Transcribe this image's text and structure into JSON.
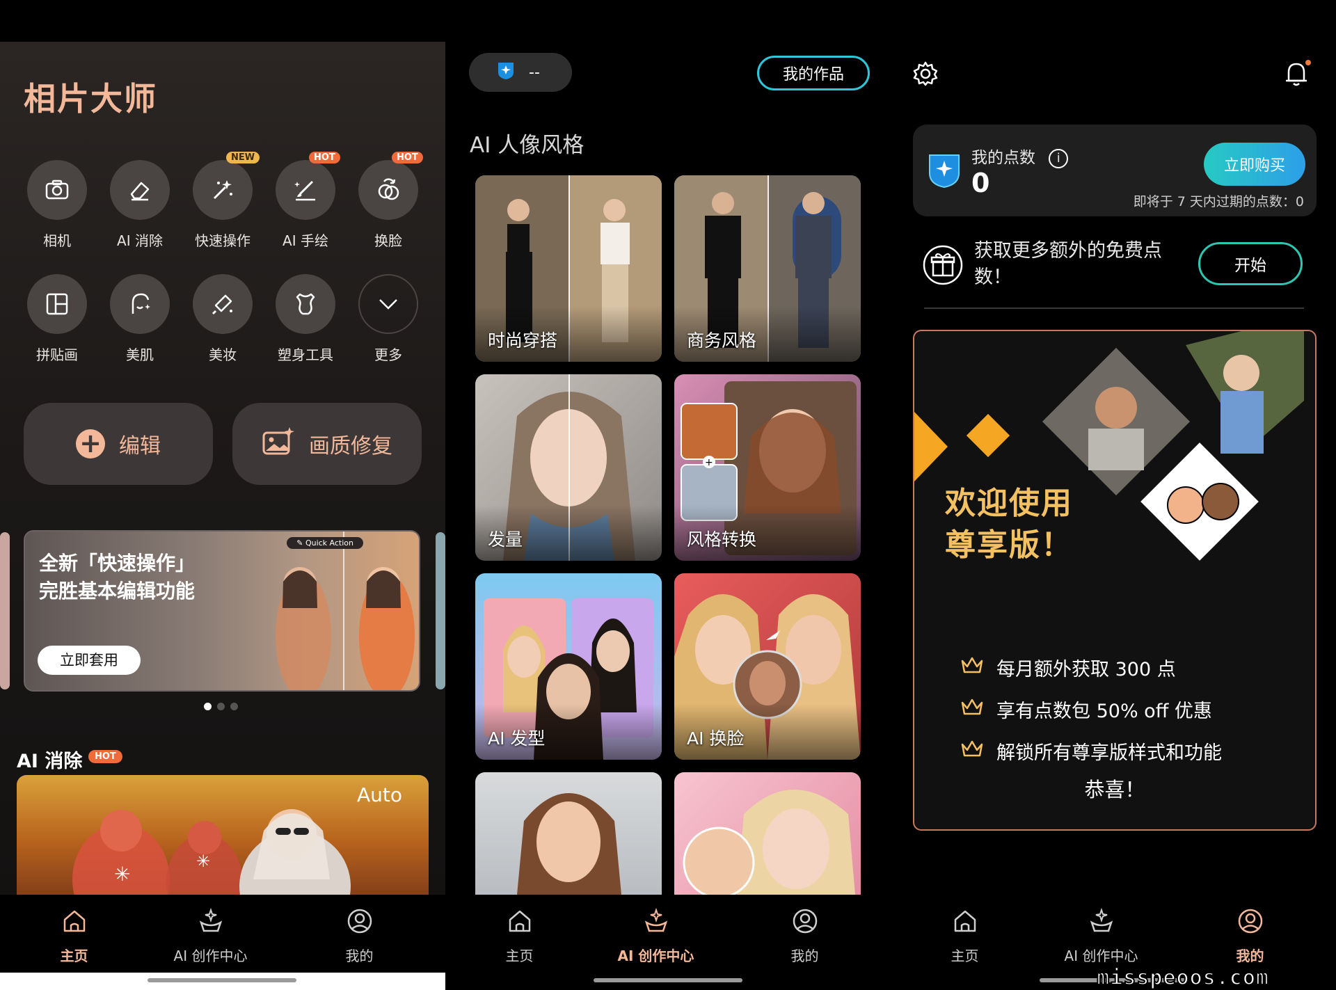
{
  "home": {
    "title": "相片大师",
    "tools_row1": [
      {
        "label": "相机",
        "icon": "camera-icon",
        "badge": ""
      },
      {
        "label": "AI 消除",
        "icon": "eraser-icon",
        "badge": ""
      },
      {
        "label": "快速操作",
        "icon": "magic-wand-icon",
        "badge": "NEW"
      },
      {
        "label": "AI 手绘",
        "icon": "brush-icon",
        "badge": "HOT"
      },
      {
        "label": "换脸",
        "icon": "face-swap-icon",
        "badge": "HOT"
      }
    ],
    "tools_row2": [
      {
        "label": "拼贴画",
        "icon": "collage-icon"
      },
      {
        "label": "美肌",
        "icon": "skin-icon"
      },
      {
        "label": "美妆",
        "icon": "makeup-brush-icon"
      },
      {
        "label": "塑身工具",
        "icon": "body-shape-icon"
      },
      {
        "label": "更多",
        "icon": "chevron-down-icon"
      }
    ],
    "edit_label": "编辑",
    "restore_label": "画质修复",
    "banner": {
      "line1": "全新「快速操作」",
      "line2": "完胜基本编辑功能",
      "pill": "Quick Action",
      "button": "立即套用"
    },
    "section_title": "AI 消除",
    "section_badge": "HOT",
    "auto_label": "Auto"
  },
  "creation": {
    "coin_value": "--",
    "works_button": "我的作品",
    "section_title": "AI 人像风格",
    "cards": [
      "时尚穿搭",
      "商务风格",
      "发量",
      "风格转换",
      "AI 发型",
      "AI 换脸"
    ]
  },
  "profile": {
    "points_label": "我的点数",
    "points_value": "0",
    "buy_button": "立即购买",
    "expire_text": "即将于 7 天内过期的点数：0",
    "free_points_text": "获取更多额外的免费点数！",
    "start_button": "开始",
    "welcome_line1": "欢迎使用",
    "welcome_line2": "尊享版！",
    "benefits": [
      "每月额外获取 300 点",
      "享有点数包 50% off 优惠",
      "解锁所有尊享版样式和功能"
    ],
    "congrats": "恭喜！"
  },
  "nav": {
    "home": "主页",
    "ai_center": "AI 创作中心",
    "mine": "我的"
  },
  "watermark": "misspeoos.com",
  "colors": {
    "accent_peach": "#f3b89a",
    "teal": "#2ec6d8",
    "gold": "#f3c062",
    "hot": "#f06a3a",
    "new": "#f0b64e"
  }
}
